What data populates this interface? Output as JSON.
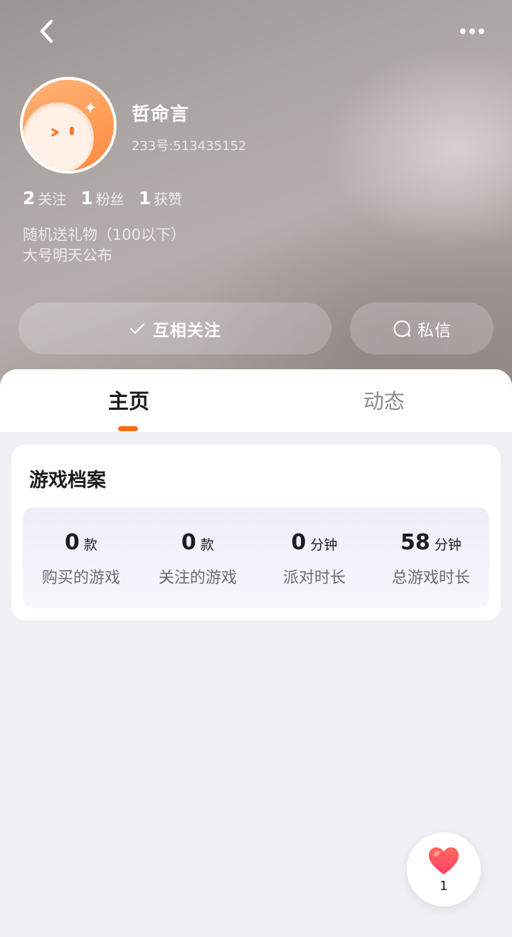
{
  "profile": {
    "name": "哲命言",
    "uid": "233号:513435152",
    "stats": [
      {
        "num": "2",
        "label": "关注"
      },
      {
        "num": "1",
        "label": "粉丝"
      },
      {
        "num": "1",
        "label": "获赞"
      }
    ],
    "bio": [
      "随机送礼物（100以下）",
      "大号明天公布"
    ]
  },
  "actions": {
    "follow_label": "互相关注",
    "message_label": "私信"
  },
  "tabs": [
    {
      "label": "主页",
      "active": true
    },
    {
      "label": "动态",
      "active": false
    }
  ],
  "game_profile": {
    "title": "游戏档案",
    "stats": [
      {
        "value": "0",
        "unit": "款",
        "caption": "购买的游戏"
      },
      {
        "value": "0",
        "unit": "款",
        "caption": "关注的游戏"
      },
      {
        "value": "0",
        "unit": "分钟",
        "caption": "派对时长"
      },
      {
        "value": "58",
        "unit": "分钟",
        "caption": "总游戏时长"
      }
    ]
  },
  "like_fab": {
    "count": "1"
  },
  "icons": {
    "back": "chevron-left-icon",
    "more": "more-dots-icon",
    "follow": "check-icon",
    "message": "chat-bubble-icon",
    "like": "heart-icon"
  },
  "colors": {
    "accent": "#ff6a1a",
    "heart": "#ff4d5a",
    "avatar": "#ff9a52"
  }
}
